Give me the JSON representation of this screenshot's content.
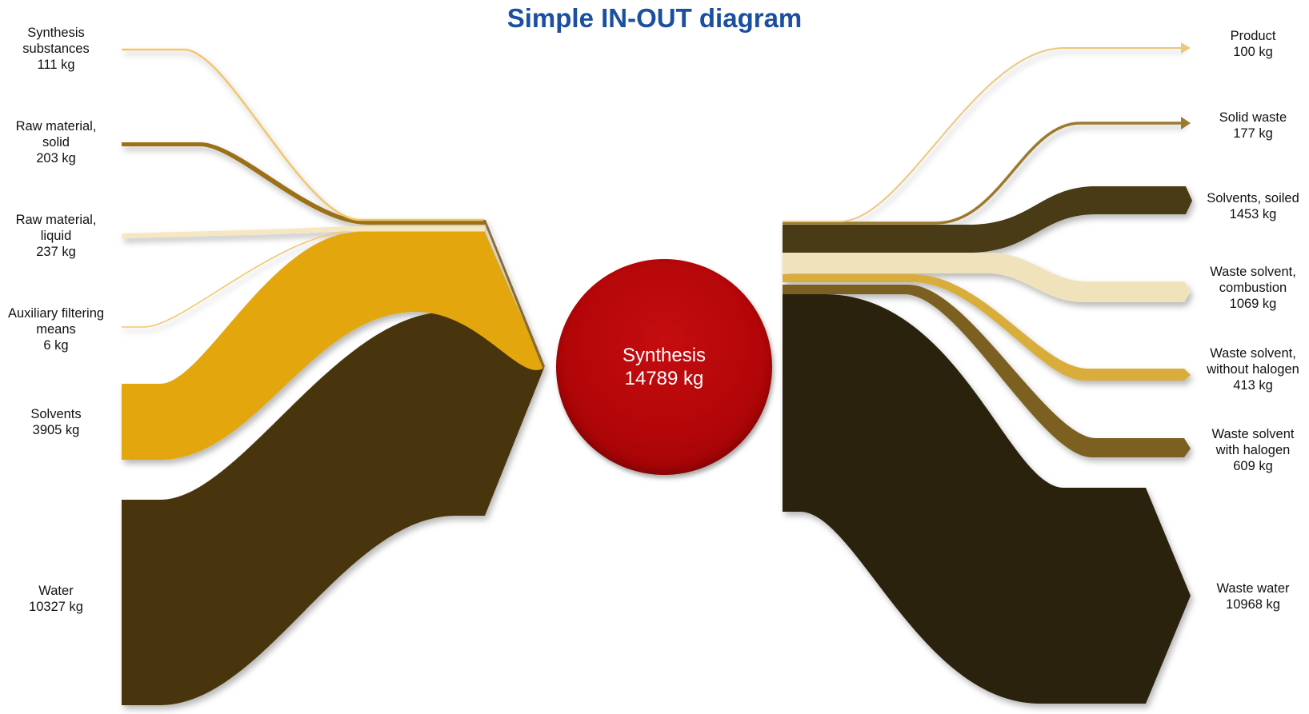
{
  "title": "Simple IN-OUT diagram",
  "center": {
    "name": "Synthesis",
    "value": "14789 kg"
  },
  "inputs": [
    {
      "lines": [
        "Synthesis",
        "substances",
        "111 kg"
      ],
      "name": "Synthesis substances",
      "value": 111,
      "color": "#f2c66a"
    },
    {
      "lines": [
        "Raw material,",
        "solid",
        "203 kg"
      ],
      "name": "Raw material, solid",
      "value": 203,
      "color": "#9c6f12"
    },
    {
      "lines": [
        "Raw material,",
        "liquid",
        "237 kg"
      ],
      "name": "Raw material, liquid",
      "value": 237,
      "color": "#f6e7c1"
    },
    {
      "lines": [
        "Auxiliary filtering",
        "means",
        "6 kg"
      ],
      "name": "Auxiliary filtering means",
      "value": 6,
      "color": "#f2c66a"
    },
    {
      "lines": [
        "Solvents",
        "3905 kg"
      ],
      "name": "Solvents",
      "value": 3905,
      "color": "#e3a60d"
    },
    {
      "lines": [
        "Water",
        "10327 kg"
      ],
      "name": "Water",
      "value": 10327,
      "color": "#4a3608"
    }
  ],
  "outputs": [
    {
      "lines": [
        "Product",
        "100 kg"
      ],
      "name": "Product",
      "value": 100,
      "color": "#eac87c"
    },
    {
      "lines": [
        "Solid waste",
        "177 kg"
      ],
      "name": "Solid waste",
      "value": 177,
      "color": "#9c7a2e"
    },
    {
      "lines": [
        "Solvents, soiled",
        "1453 kg"
      ],
      "name": "Solvents, soiled",
      "value": 1453,
      "color": "#4a3a12"
    },
    {
      "lines": [
        "Waste solvent,",
        "combustion",
        "1069 kg"
      ],
      "name": "Waste solvent, combustion",
      "value": 1069,
      "color": "#f0e2bb"
    },
    {
      "lines": [
        "Waste solvent,",
        "without halogen",
        "413 kg"
      ],
      "name": "Waste solvent, without halogen",
      "value": 413,
      "color": "#d8ad3a"
    },
    {
      "lines": [
        "Waste solvent",
        "with halogen",
        "609 kg"
      ],
      "name": "Waste solvent with halogen",
      "value": 609,
      "color": "#7b6024"
    },
    {
      "lines": [
        "Waste water",
        "10968 kg"
      ],
      "name": "Waste water",
      "value": 10968,
      "color": "#29200b"
    }
  ]
}
